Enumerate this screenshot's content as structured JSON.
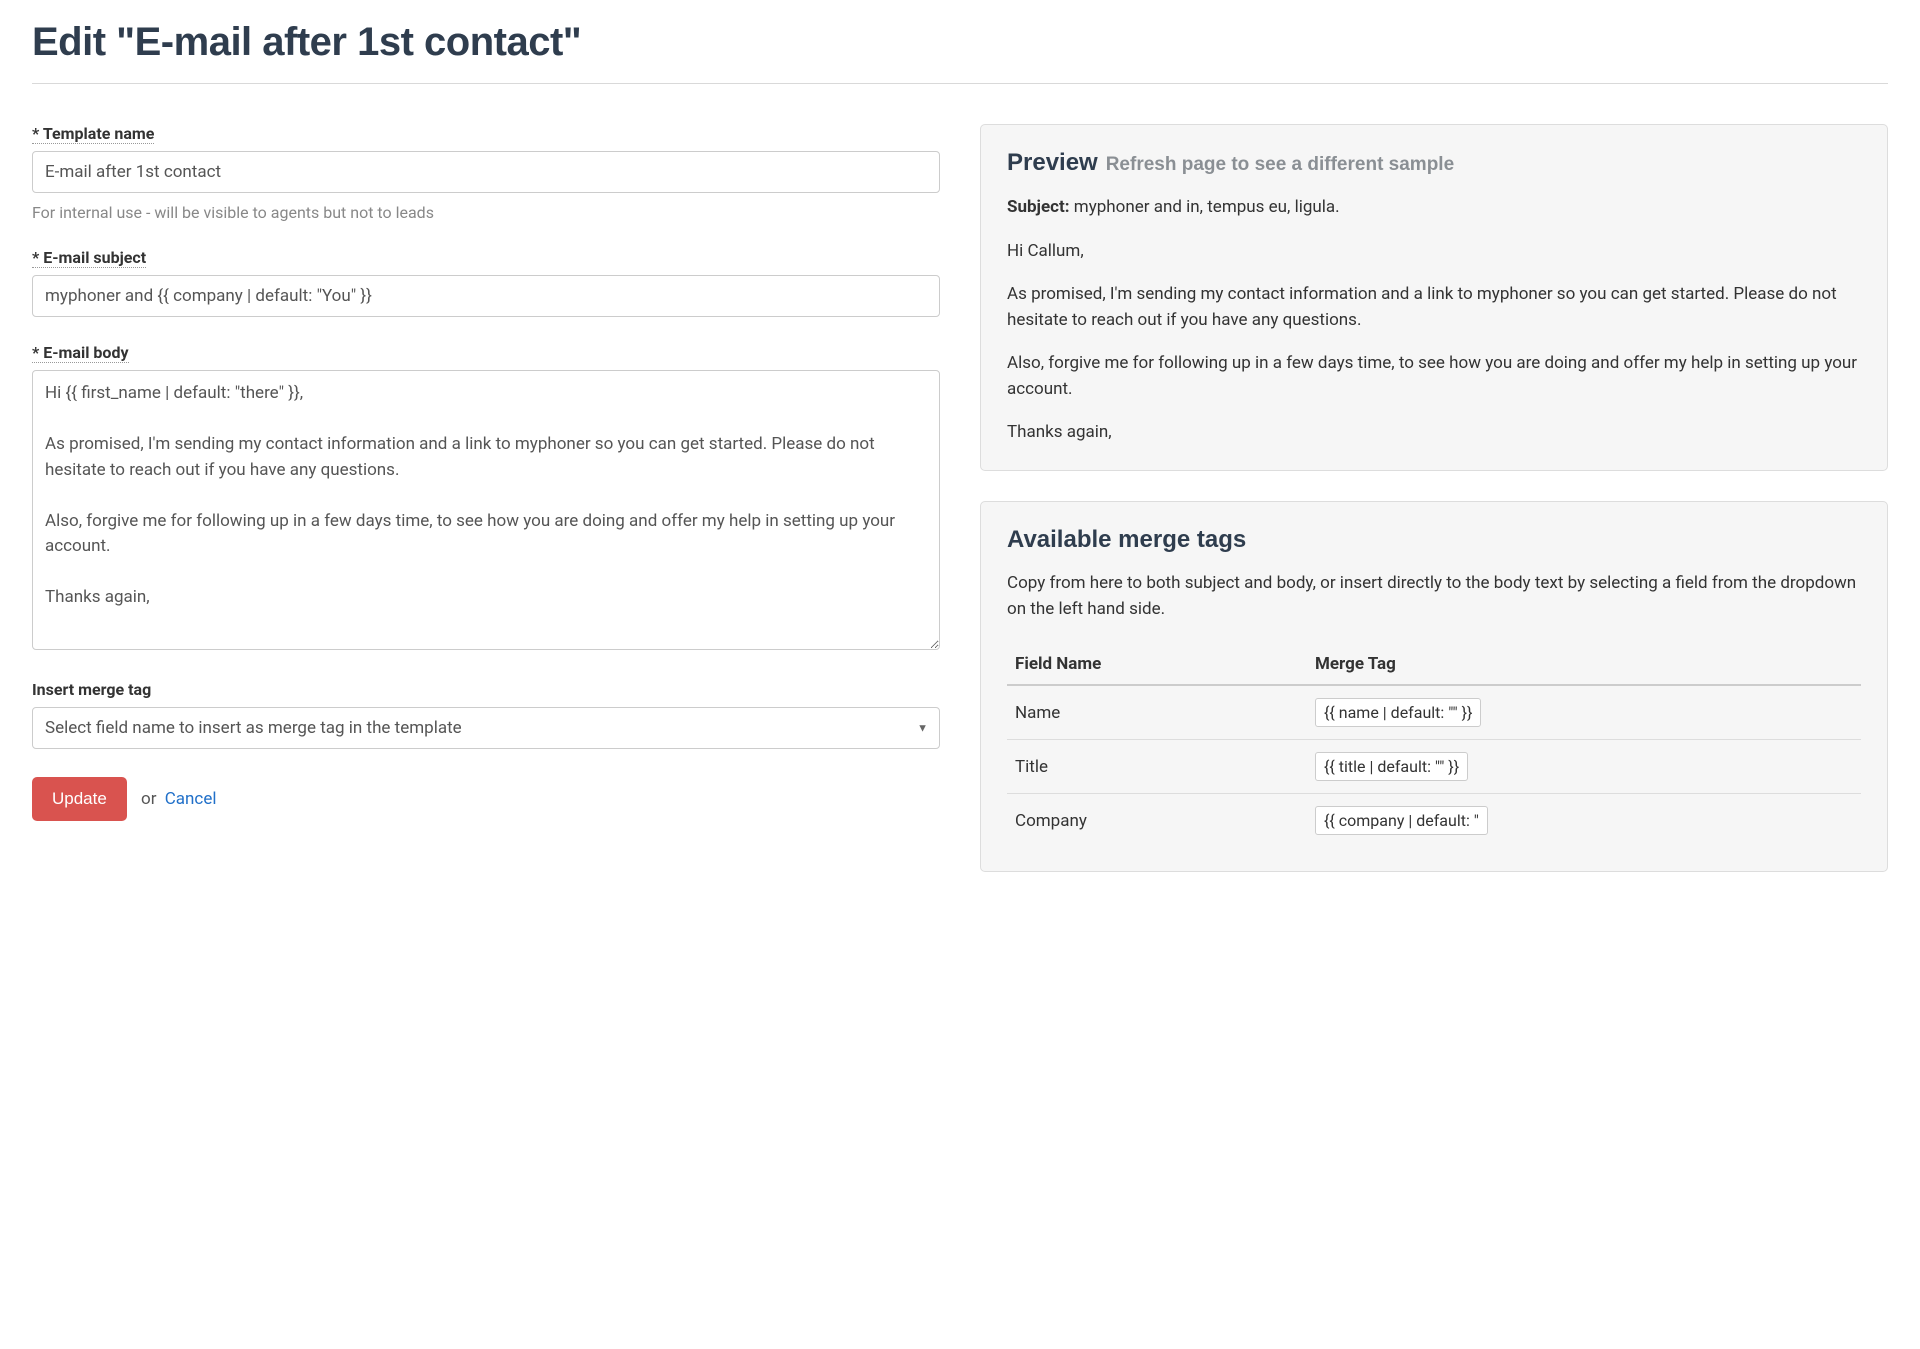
{
  "header": {
    "title": "Edit \"E-mail after 1st contact\""
  },
  "form": {
    "template_name": {
      "label": "* Template name",
      "value": "E-mail after 1st contact",
      "help": "For internal use - will be visible to agents but not to leads"
    },
    "email_subject": {
      "label": "* E-mail subject",
      "value": "myphoner and {{ company | default: \"You\" }}"
    },
    "email_body": {
      "label": "* E-mail body",
      "value": "Hi {{ first_name | default: \"there\" }},\n\nAs promised, I'm sending my contact information and a link to myphoner so you can get started. Please do not hesitate to reach out if you have any questions.\n\nAlso, forgive me for following up in a few days time, to see how you are doing and offer my help in setting up your account.\n\nThanks again,"
    },
    "merge_tag": {
      "label": "Insert merge tag",
      "placeholder": "Select field name to insert as merge tag in the template"
    },
    "actions": {
      "update": "Update",
      "or": "or",
      "cancel": "Cancel"
    }
  },
  "preview": {
    "heading": "Preview",
    "sub": "Refresh page to see a different sample",
    "subject_label": "Subject:",
    "subject_value": "myphoner and in, tempus eu, ligula.",
    "greeting": "Hi Callum,",
    "p1": "As promised, I'm sending my contact information and a link to myphoner so you can get started. Please do not hesitate to reach out if you have any questions.",
    "p2": "Also, forgive me for following up in a few days time, to see how you are doing and offer my help in setting up your account.",
    "signoff": "Thanks again,"
  },
  "merge": {
    "heading": "Available merge tags",
    "info": "Copy from here to both subject and body, or insert directly to the body text by selecting a field from the dropdown on the left hand side.",
    "col_field": "Field Name",
    "col_tag": "Merge Tag",
    "rows": [
      {
        "field": "Name",
        "tag": "{{ name | default: \"\" }}"
      },
      {
        "field": "Title",
        "tag": "{{ title | default: \"\" }}"
      },
      {
        "field": "Company",
        "tag": "{{ company | default: \""
      }
    ]
  }
}
